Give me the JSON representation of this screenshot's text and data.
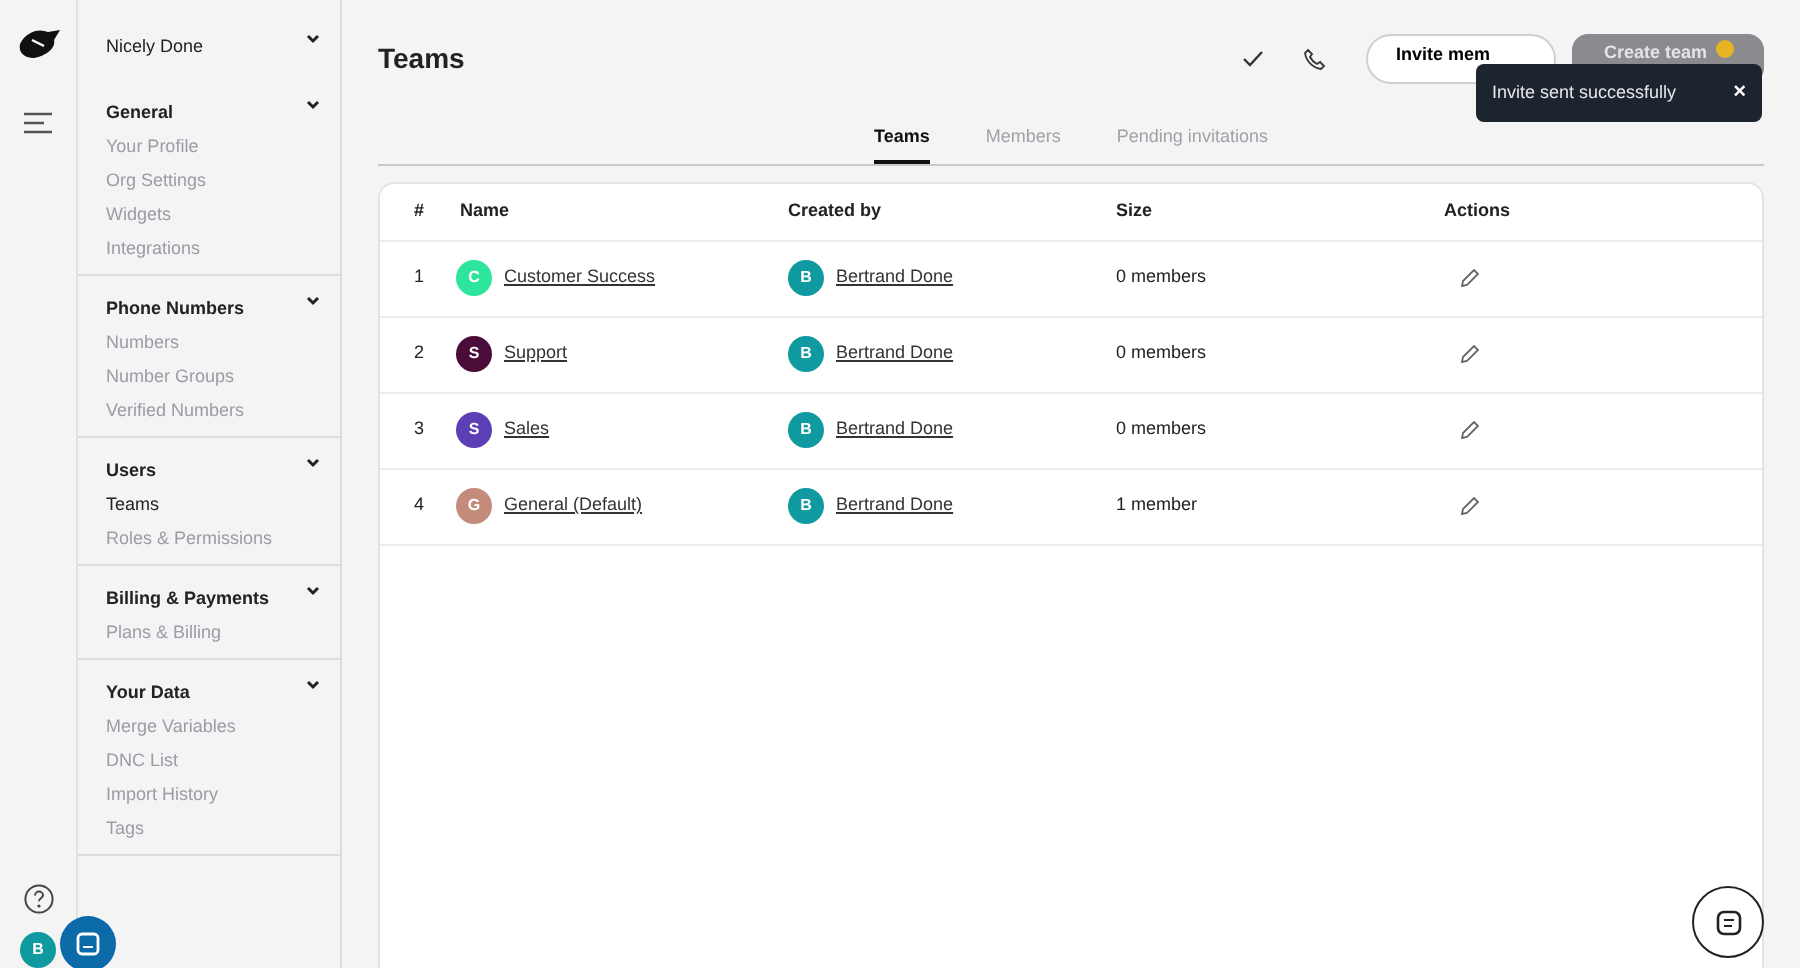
{
  "workspace": {
    "name": "Nicely Done"
  },
  "sidebar": {
    "sections": [
      {
        "title": "General",
        "expanded": true,
        "items": [
          {
            "label": "Your Profile",
            "selected": false
          },
          {
            "label": "Org Settings",
            "selected": false
          },
          {
            "label": "Widgets",
            "selected": false
          },
          {
            "label": "Integrations",
            "selected": false
          }
        ]
      },
      {
        "title": "Phone Numbers",
        "expanded": true,
        "items": [
          {
            "label": "Numbers",
            "selected": false
          },
          {
            "label": "Number Groups",
            "selected": false
          },
          {
            "label": "Verified Numbers",
            "selected": false
          }
        ]
      },
      {
        "title": "Users",
        "expanded": true,
        "items": [
          {
            "label": "Teams",
            "selected": true
          },
          {
            "label": "Roles & Permissions",
            "selected": false
          }
        ]
      },
      {
        "title": "Billing & Payments",
        "expanded": true,
        "items": [
          {
            "label": "Plans & Billing",
            "selected": false
          }
        ]
      },
      {
        "title": "Your Data",
        "expanded": true,
        "items": [
          {
            "label": "Merge Variables",
            "selected": false
          },
          {
            "label": "DNC List",
            "selected": false
          },
          {
            "label": "Import History",
            "selected": false
          },
          {
            "label": "Tags",
            "selected": false
          }
        ]
      }
    ]
  },
  "user": {
    "initial": "B"
  },
  "page": {
    "title": "Teams",
    "invite_button": "Invite mem",
    "create_button": "Create team"
  },
  "tabs": [
    {
      "label": "Teams",
      "selected": true
    },
    {
      "label": "Members",
      "selected": false
    },
    {
      "label": "Pending invitations",
      "selected": false
    }
  ],
  "table": {
    "columns": [
      "#",
      "Name",
      "Created by",
      "Size",
      "Actions"
    ],
    "rows": [
      {
        "index": "1",
        "initial": "C",
        "name": "Customer Success",
        "color": "#2ee59d",
        "creator_initial": "B",
        "creator": "Bertrand Done",
        "size": "0 members"
      },
      {
        "index": "2",
        "initial": "S",
        "name": "Support",
        "color": "#4a0d3a",
        "creator_initial": "B",
        "creator": "Bertrand Done",
        "size": "0 members"
      },
      {
        "index": "3",
        "initial": "S",
        "name": "Sales",
        "color": "#5b3fb5",
        "creator_initial": "B",
        "creator": "Bertrand Done",
        "size": "0 members"
      },
      {
        "index": "4",
        "initial": "G",
        "name": "General (Default)",
        "color": "#c48b7a",
        "creator_initial": "B",
        "creator": "Bertrand Done",
        "size": "1 member"
      }
    ]
  },
  "toast": {
    "message": "Invite sent successfully",
    "close": "×"
  }
}
